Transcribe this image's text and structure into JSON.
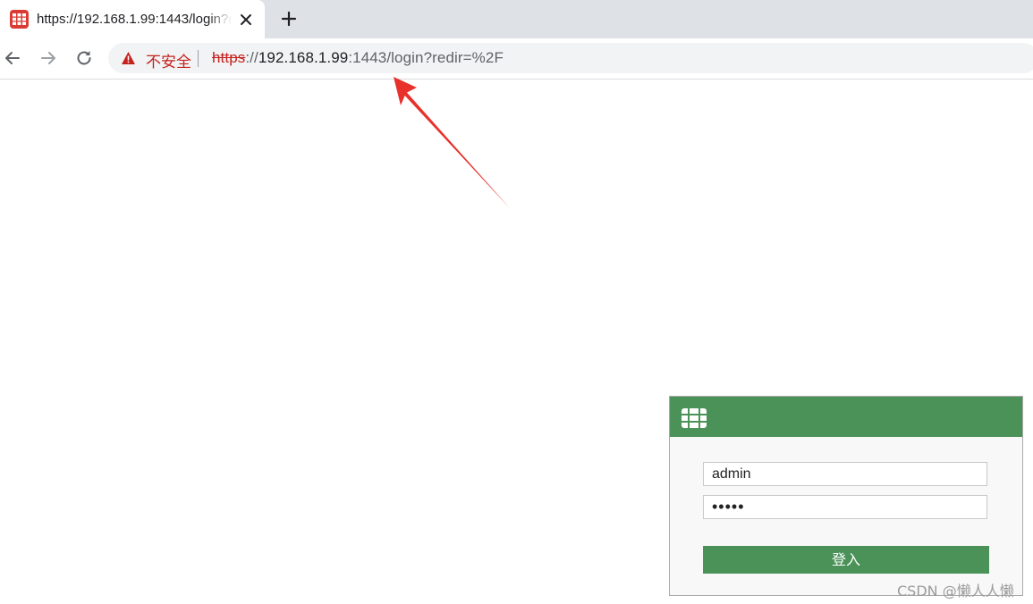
{
  "tab": {
    "title": "https://192.168.1.99:1443/login?redir=%2F",
    "favicon": "fortinet-icon",
    "close_icon": "close-icon",
    "new_tab_icon": "plus-icon"
  },
  "toolbar": {
    "back_icon": "arrow-left-icon",
    "forward_icon": "arrow-right-icon",
    "reload_icon": "reload-icon"
  },
  "address_bar": {
    "security_icon": "warning-triangle-icon",
    "security_label": "不安全",
    "url": {
      "scheme": "https",
      "separator": "://",
      "host": "192.168.1.99",
      "rest": ":1443/login?redir=%2F"
    }
  },
  "annotation": {
    "arrow_color": "#e8312a"
  },
  "login": {
    "header_color": "#4a9257",
    "logo": "fortinet-logo-icon",
    "username_value": "admin",
    "password_value": "admin",
    "submit_label": "登入"
  },
  "watermark": {
    "text": "CSDN @懒人人懒"
  }
}
